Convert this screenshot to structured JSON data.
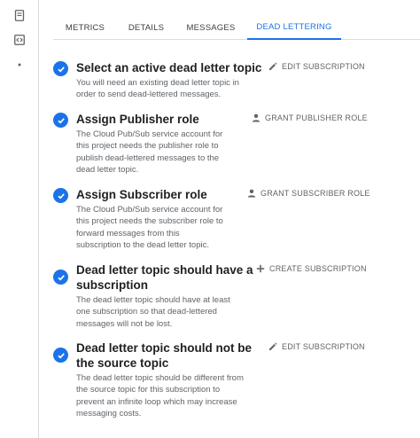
{
  "rail": {
    "items": [
      {
        "icon": "document-icon"
      },
      {
        "icon": "code-icon"
      },
      {
        "icon": "dot-icon"
      }
    ]
  },
  "tabs": [
    {
      "label": "METRICS",
      "active": false
    },
    {
      "label": "DETAILS",
      "active": false
    },
    {
      "label": "MESSAGES",
      "active": false
    },
    {
      "label": "DEAD LETTERING",
      "active": true
    }
  ],
  "steps": [
    {
      "title_lines": [
        "Select an active dead letter topic"
      ],
      "desc_lines": [
        "You will need an existing dead letter topic in",
        "order to send dead-lettered messages."
      ],
      "action_label": "EDIT SUBSCRIPTION",
      "action_icon": "pencil-icon"
    },
    {
      "title_lines": [
        "Assign Publisher role"
      ],
      "desc_lines": [
        "The Cloud Pub/Sub service account for",
        "this project needs the publisher role to",
        "publish dead-lettered messages to the",
        "dead letter topic."
      ],
      "action_label": "GRANT PUBLISHER ROLE",
      "action_icon": "person-icon"
    },
    {
      "title_lines": [
        "Assign Subscriber role"
      ],
      "desc_lines": [
        "The Cloud Pub/Sub service account for",
        "this project needs the subscriber role to",
        "forward messages from this",
        "subscription to the dead letter topic."
      ],
      "action_label": "GRANT SUBSCRIBER ROLE",
      "action_icon": "person-icon"
    },
    {
      "title_lines": [
        "Dead letter topic should have a",
        "subscription"
      ],
      "desc_lines": [
        "The dead letter topic should have at least",
        "one subscription so that dead-lettered",
        "messages will not be lost."
      ],
      "action_label": "CREATE SUBSCRIPTION",
      "action_icon": "plus-icon"
    },
    {
      "title_lines": [
        "Dead letter topic should not be",
        "the source topic"
      ],
      "desc_lines": [
        "The dead letter topic should be different from",
        "the source topic for this subscription to",
        "prevent an infinite loop which may increase",
        "messaging costs."
      ],
      "action_label": "EDIT SUBSCRIPTION",
      "action_icon": "pencil-icon"
    }
  ],
  "colors": {
    "accent": "#1a73e8",
    "text": "#202124",
    "muted": "#5f6368",
    "divider": "#dadce0"
  }
}
